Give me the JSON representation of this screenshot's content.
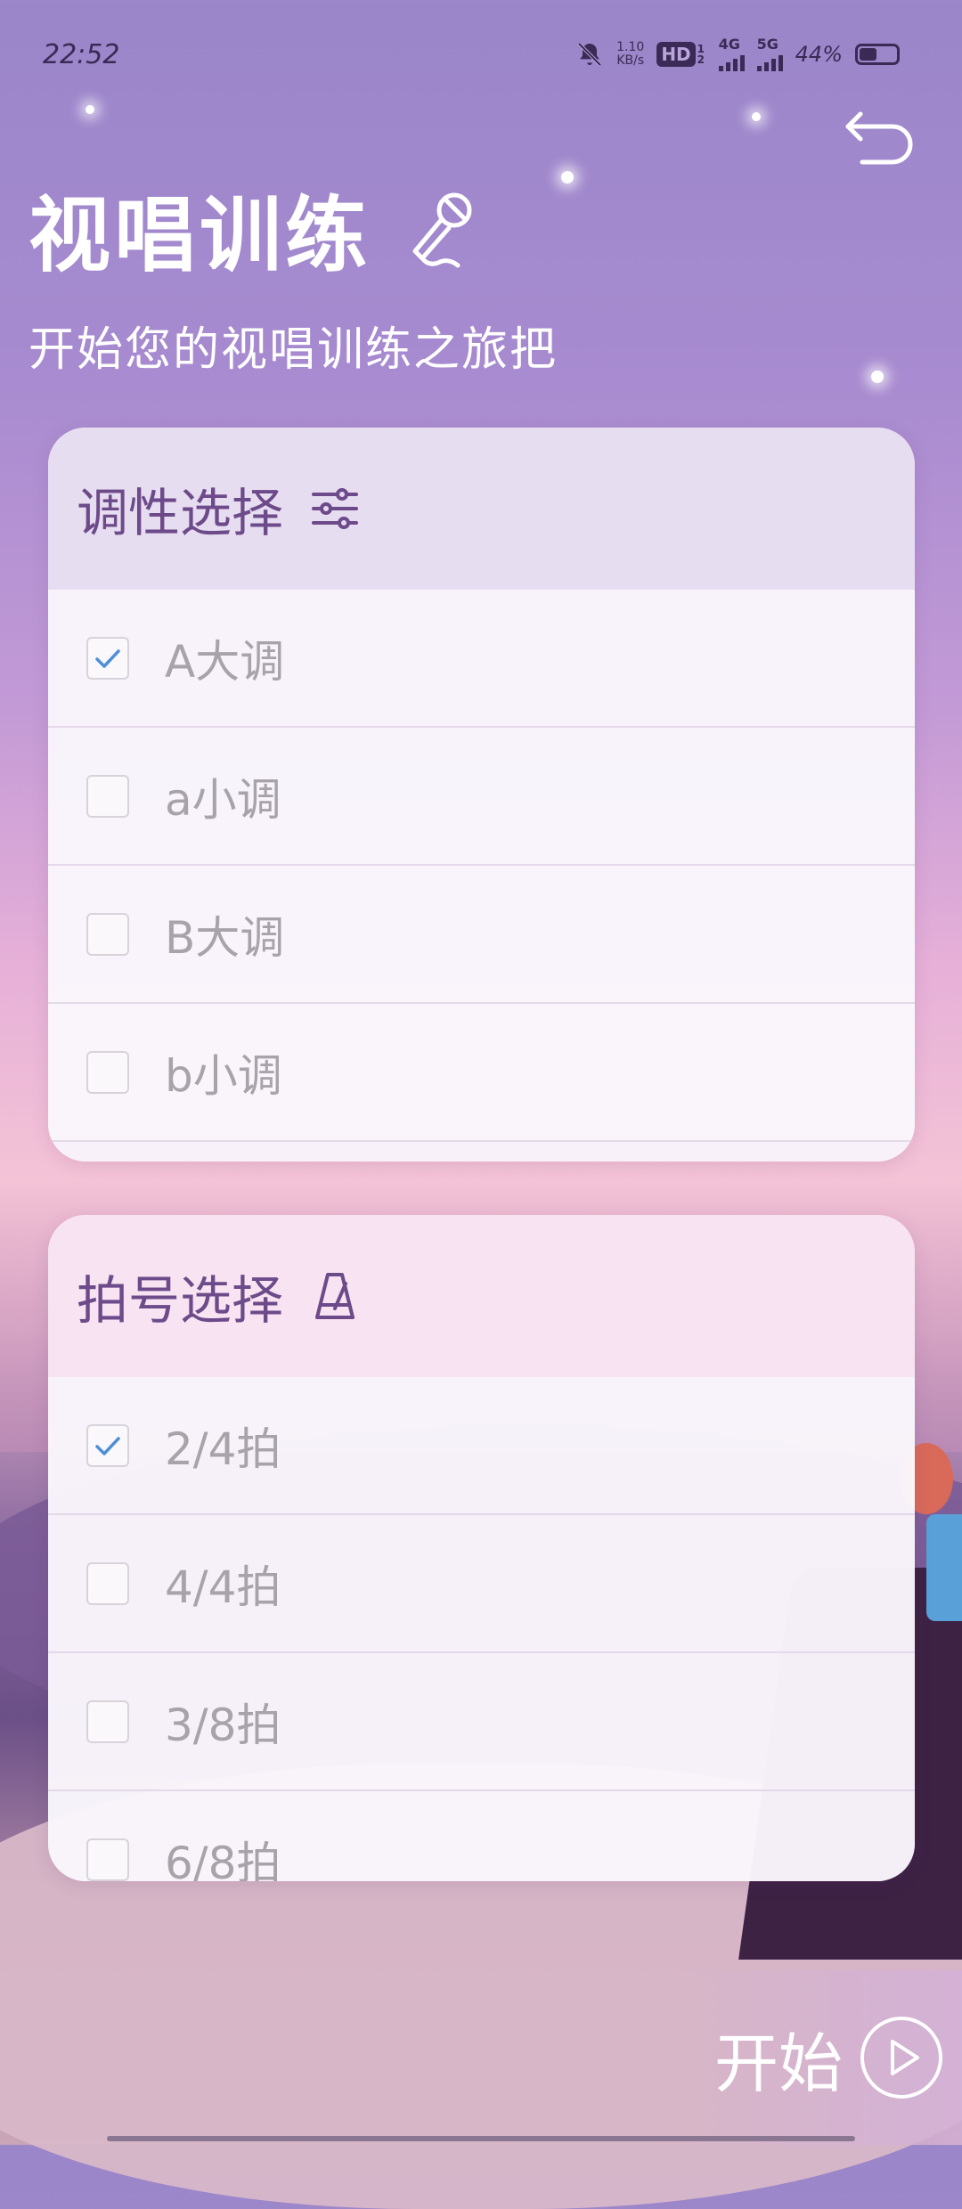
{
  "status_bar": {
    "time": "22:52",
    "net_speed": "1.10",
    "net_unit": "KB/s",
    "hd": "HD",
    "hd_sub": "1 2",
    "net1": "4G",
    "net2": "5G",
    "battery_percent": "44%",
    "battery_level": 0.44,
    "icons": [
      "bell-off-icon",
      "hd-icon",
      "signal-4g-icon",
      "signal-5g-icon",
      "battery-icon"
    ]
  },
  "header": {
    "back_icon": "undo-arrow-icon",
    "title": "视唱训练",
    "title_icon": "microphone-icon",
    "subtitle": "开始您的视唱训练之旅把"
  },
  "key_card": {
    "title": "调性选择",
    "icon": "sliders-icon",
    "options": [
      {
        "label": "A大调",
        "checked": true
      },
      {
        "label": "a小调",
        "checked": false
      },
      {
        "label": "B大调",
        "checked": false
      },
      {
        "label": "b小调",
        "checked": false
      }
    ]
  },
  "meter_card": {
    "title": "拍号选择",
    "icon": "metronome-icon",
    "options": [
      {
        "label": "2/4拍",
        "checked": true
      },
      {
        "label": "4/4拍",
        "checked": false
      },
      {
        "label": "3/8拍",
        "checked": false
      },
      {
        "label": "6/8拍",
        "checked": false
      }
    ]
  },
  "start_button": {
    "label": "开始",
    "icon": "play-circle-icon"
  },
  "colors": {
    "accent": "#6d4a8a",
    "check": "#4f8fd6",
    "muted_text": "#a8a2ab"
  }
}
